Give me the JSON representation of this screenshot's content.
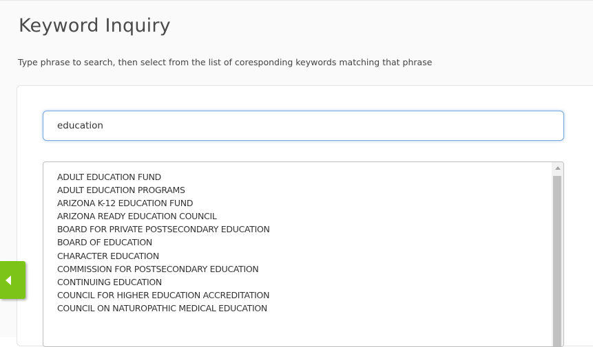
{
  "header": {
    "title": "Keyword Inquiry",
    "subtitle": "Type phrase to search, then select from the list of coresponding keywords matching that phrase"
  },
  "search": {
    "value": "education"
  },
  "keywords": [
    "ADULT EDUCATION FUND",
    "ADULT EDUCATION PROGRAMS",
    "ARIZONA K-12 EDUCATION FUND",
    "ARIZONA READY EDUCATION COUNCIL",
    "BOARD FOR PRIVATE POSTSECONDARY EDUCATION",
    "BOARD OF EDUCATION",
    "CHARACTER EDUCATION",
    "COMMISSION FOR POSTSECONDARY EDUCATION",
    "CONTINUING EDUCATION",
    "COUNCIL FOR HIGHER EDUCATION ACCREDITATION",
    "COUNCIL ON NATUROPATHIC MEDICAL EDUCATION"
  ],
  "icons": {
    "side_tab": "chevron-left-icon",
    "scroll_up": "arrow-up-icon"
  },
  "colors": {
    "accent_green": "#7cc418",
    "input_focus_border": "#7aa8dc",
    "title_text": "#4a4a4a"
  }
}
